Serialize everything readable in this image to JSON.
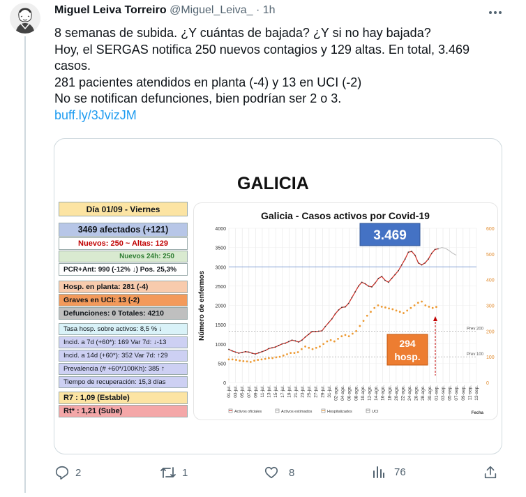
{
  "tweet": {
    "author_name": "Miguel Leiva Torreiro",
    "handle": "@Miguel_Leiva_",
    "separator": "·",
    "time": "1h",
    "lines": [
      "8 semanas de subida. ¿Y cuántas de bajada? ¿Y si no hay bajada?",
      "Hoy, el SERGAS notifica 250 nuevos contagios y 129 altas. En total, 3.469 casos.",
      "281 pacientes atendidos en planta (-4) y 13 en UCI (-2)",
      "No se notifican defunciones, bien podrían ser 2 o 3."
    ],
    "link": "buff.ly/3JvizJM"
  },
  "media": {
    "region_title": "GALICIA",
    "panel": {
      "day": "Día 01/09 - Viernes",
      "affected": "3469 afectados (+121)",
      "nuevos_altas": "Nuevos:  250  ~ Altas:  129",
      "nuevos_24h": "Nuevos 24h:  250",
      "pcr": "PCR+Ant:  990  (-12% ↓)  Pos. 25,3%",
      "hosp_planta": "Hosp. en planta:  281 (-4)",
      "graves_uci": "Graves en UCI:          13 (-2)",
      "defunciones": "Defunciones: 0   Totales: 4210",
      "tasa_hosp": "Tasa hosp. sobre activos:   8,5 %  ↓",
      "incid7": "Incid. a 7d (+60*):   169  Var 7d:  ↓-13",
      "incid14": "Incid. a 14d (+60*): 352  Var 7d:  ↑29",
      "prevalencia": "Prevalencia (# +60*/100Kh):  385 ↑",
      "recuperacion": "Tiempo de recuperación: 15,3 días",
      "r7": "R7 :   1,09 (Estable)",
      "rt": "Rt* :   1,21 (Sube)"
    },
    "colors": {
      "panel_yellow": "#fce4a3",
      "panel_blue": "#b7c6e7",
      "panel_green": "#d9ead0",
      "panel_white": "#ffffff",
      "panel_peach": "#f8cbad",
      "panel_orange": "#f39a5b",
      "panel_gray": "#bfbfbf",
      "panel_cyan": "#d9f2f8",
      "panel_lavender": "#cdd0f3",
      "panel_pink": "#f4a7a8",
      "red_text": "#c00000",
      "green_text": "#2e7d32",
      "blue_box": "#4472c4",
      "orange_box": "#ed7d31",
      "accent_blue": "#1d9bf0"
    }
  },
  "chart_data": {
    "type": "line",
    "title": "Galicia  -  Casos activos por Covid-19",
    "ylabel": "Número de enfermos",
    "xlabel": "Fecha",
    "ylim": [
      0,
      4000
    ],
    "y2lim": [
      0,
      600
    ],
    "yticks": [
      0,
      500,
      1000,
      1500,
      2000,
      2500,
      3000,
      3500,
      4000
    ],
    "y2ticks": [
      0,
      100,
      200,
      300,
      400,
      500,
      600
    ],
    "x_labels": [
      "01-jul.",
      "03-jul.",
      "05-jul.",
      "07-jul.",
      "09-jul.",
      "11-jul.",
      "13-jul.",
      "15-jul.",
      "17-jul.",
      "19-jul.",
      "21-jul.",
      "23-jul.",
      "25-jul.",
      "27-jul.",
      "29-jul.",
      "31-jul.",
      "02-ago.",
      "04-ago.",
      "06-ago.",
      "08-ago.",
      "10-ago.",
      "12-ago.",
      "14-ago.",
      "16-ago.",
      "18-ago.",
      "20-ago.",
      "22-ago.",
      "24-ago.",
      "26-ago.",
      "28-ago.",
      "30-ago.",
      "01-sep.",
      "03-sep.",
      "05-sep.",
      "07-sep.",
      "09-sep.",
      "11-sep.",
      "13-sep."
    ],
    "series": [
      {
        "name": "Activos oficiales",
        "color": "#d0342c",
        "axis": "left",
        "values": [
          860,
          820,
          790,
          760,
          780,
          800,
          790,
          760,
          740,
          770,
          800,
          830,
          880,
          900,
          920,
          960,
          1000,
          1020,
          1060,
          1100,
          1080,
          1050,
          1100,
          1180,
          1250,
          1320,
          1320,
          1330,
          1340,
          1450,
          1550,
          1650,
          1780,
          1880,
          1950,
          1960,
          2050,
          2200,
          2350,
          2500,
          2600,
          2560,
          2500,
          2480,
          2580,
          2700,
          2750,
          2650,
          2600,
          2700,
          2800,
          2900,
          3050,
          3200,
          3380,
          3400,
          3300,
          3100,
          3050,
          3100,
          3200,
          3350,
          3450,
          3469
        ]
      },
      {
        "name": "Activos estimados",
        "color": "#bfbfbf",
        "axis": "left",
        "values": [
          3469,
          3500,
          3480,
          3420,
          3350,
          3300
        ]
      },
      {
        "name": "Hospitalizados",
        "color": "#ed9a33",
        "axis": "right",
        "values": [
          90,
          90,
          88,
          85,
          83,
          82,
          80,
          85,
          88,
          90,
          92,
          95,
          95,
          98,
          100,
          105,
          110,
          115,
          115,
          118,
          130,
          140,
          135,
          130,
          135,
          140,
          150,
          160,
          165,
          160,
          170,
          180,
          185,
          180,
          190,
          200,
          220,
          240,
          260,
          275,
          290,
          300,
          295,
          292,
          288,
          285,
          280,
          275,
          270,
          280,
          290,
          300,
          310,
          315,
          300,
          295,
          290,
          294
        ]
      },
      {
        "name": "UCI",
        "color": "#a6a6a6",
        "axis": "right",
        "values": []
      }
    ],
    "reference_lines": [
      {
        "label": "Prev 200",
        "value": 200,
        "axis": "right"
      },
      {
        "label": "Prev 100",
        "value": 100,
        "axis": "right"
      }
    ],
    "annotations": [
      {
        "text": "3.469"
      },
      {
        "text": "294 hosp."
      }
    ]
  },
  "actions": {
    "replies": "2",
    "retweets": "1",
    "likes": "8",
    "views": "76"
  }
}
